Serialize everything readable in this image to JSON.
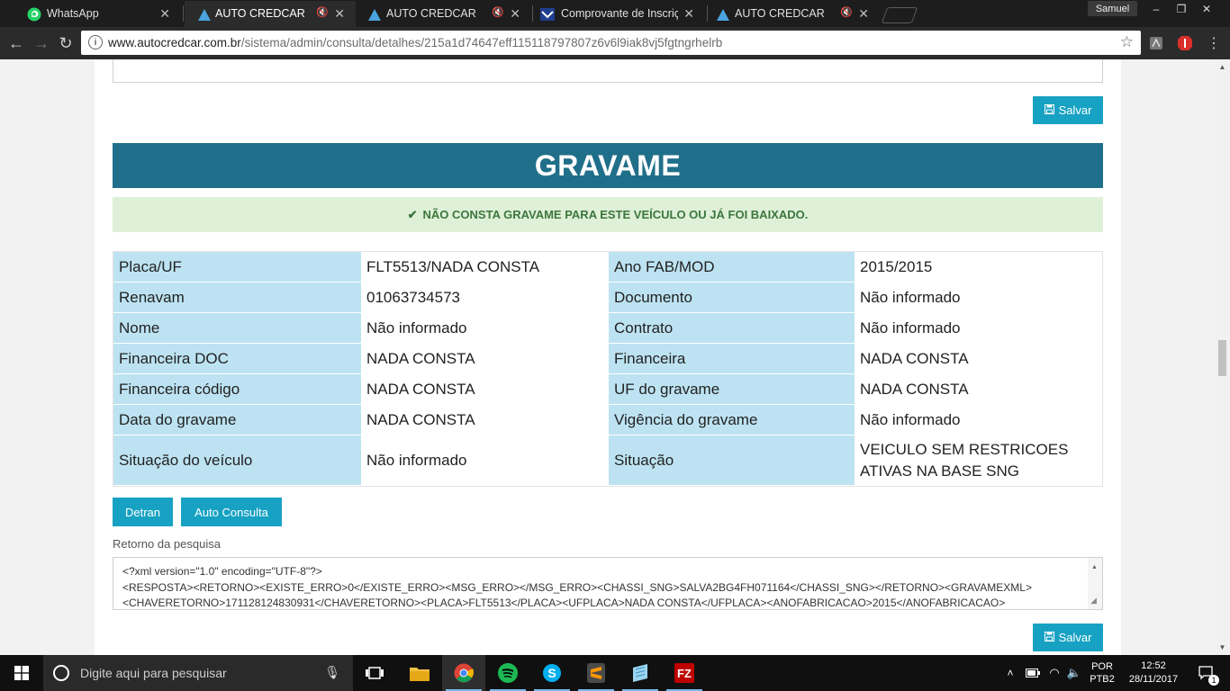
{
  "browser": {
    "tabs": [
      {
        "title": "WhatsApp",
        "icon": "whatsapp-icon",
        "active": false,
        "muted": false
      },
      {
        "title": "AUTO CREDCAR",
        "icon": "autocredcar-icon",
        "active": true,
        "muted": true
      },
      {
        "title": "AUTO CREDCAR",
        "icon": "autocredcar-icon",
        "active": false,
        "muted": true
      },
      {
        "title": "Comprovante de Inscriçã",
        "icon": "receita-icon",
        "active": false,
        "muted": false
      },
      {
        "title": "AUTO CREDCAR",
        "icon": "autocredcar-icon",
        "active": false,
        "muted": true
      }
    ],
    "profile_name": "Samuel",
    "url_host": "www.autocredcar.com.br",
    "url_path": "/sistema/admin/consulta/detalhes/215a1d74647eff115118797807z6v6l9iak8vj5fgtngrhelrb"
  },
  "page": {
    "save_label": "Salvar",
    "section_title": "GRAVAME",
    "alert_text": "NÃO CONSTA GRAVAME PARA ESTE VEÍCULO OU JÁ FOI BAIXADO.",
    "rows": [
      {
        "l1": "Placa/UF",
        "v1": "FLT5513/NADA CONSTA",
        "l2": "Ano FAB/MOD",
        "v2": "2015/2015"
      },
      {
        "l1": "Renavam",
        "v1": "01063734573",
        "l2": "Documento",
        "v2": "Não informado"
      },
      {
        "l1": "Nome",
        "v1": "Não informado",
        "l2": "Contrato",
        "v2": "Não informado"
      },
      {
        "l1": "Financeira DOC",
        "v1": "NADA CONSTA",
        "l2": "Financeira",
        "v2": "NADA CONSTA"
      },
      {
        "l1": "Financeira código",
        "v1": "NADA CONSTA",
        "l2": "UF do gravame",
        "v2": "NADA CONSTA"
      },
      {
        "l1": "Data do gravame",
        "v1": "NADA CONSTA",
        "l2": "Vigência do gravame",
        "v2": "Não informado"
      },
      {
        "l1": "Situação do veículo",
        "v1": "Não informado",
        "l2": "Situação",
        "v2": "VEICULO SEM RESTRICOES ATIVAS NA BASE SNG"
      }
    ],
    "detran_label": "Detran",
    "auto_consulta_label": "Auto Consulta",
    "retorno_label": "Retorno da pesquisa",
    "xml_lines": [
      "<?xml version=\"1.0\" encoding=\"UTF-8\"?>",
      "<RESPOSTA><RETORNO><EXISTE_ERRO>0</EXISTE_ERRO><MSG_ERRO></MSG_ERRO><CHASSI_SNG>SALVA2BG4FH071164</CHASSI_SNG></RETORNO><GRAVAMEXML>",
      "<CHAVERETORNO>171128124830931</CHAVERETORNO><PLACA>FLT5513</PLACA><UFPLACA>NADA CONSTA</UFPLACA><ANOFABRICACAO>2015</ANOFABRICACAO>"
    ]
  },
  "taskbar": {
    "search_placeholder": "Digite aqui para pesquisar",
    "lang_top": "POR",
    "lang_bottom": "PTB2",
    "time": "12:52",
    "date": "28/11/2017",
    "notification_count": "1"
  },
  "colors": {
    "banner": "#206f8a",
    "button": "#17a2c3",
    "label_cell": "#bde3f2",
    "alert_bg": "#dff0d8",
    "alert_text": "#3c763d"
  }
}
